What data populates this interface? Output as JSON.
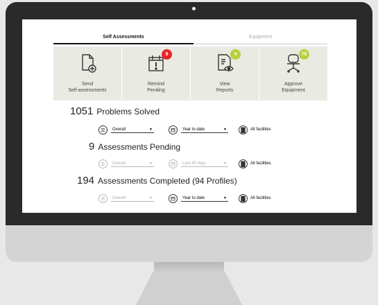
{
  "tabs": [
    {
      "label": "Self Assessments"
    },
    {
      "label": "Equipment"
    }
  ],
  "tiles": [
    {
      "line1": "Send",
      "line2": "Self-assessments",
      "icon": "send-document-icon",
      "badge": null
    },
    {
      "line1": "Remind",
      "line2": "Pending",
      "icon": "calendar-alert-icon",
      "badge": "9",
      "badge_color": "#e8242b"
    },
    {
      "line1": "View",
      "line2": "Reports",
      "icon": "report-eye-icon",
      "badge": "4",
      "badge_color": "#b6d13a"
    },
    {
      "line1": "Approve",
      "line2": "Equipment",
      "icon": "office-chair-icon",
      "badge": "70",
      "badge_color": "#b6d13a"
    }
  ],
  "stats": [
    {
      "number": "1051",
      "text": "Problems Solved",
      "scope": "Overall",
      "period": "Year to date",
      "facilities": "All facilities"
    },
    {
      "number": "9",
      "text": "Assessments Pending",
      "scope": "Overall",
      "period": "Last 45 days",
      "facilities": "All facilities"
    },
    {
      "number": "194",
      "text": "Assessments Completed (94 Profiles)",
      "scope": "Overall",
      "period": "Year to date",
      "facilities": "All facilities"
    }
  ]
}
